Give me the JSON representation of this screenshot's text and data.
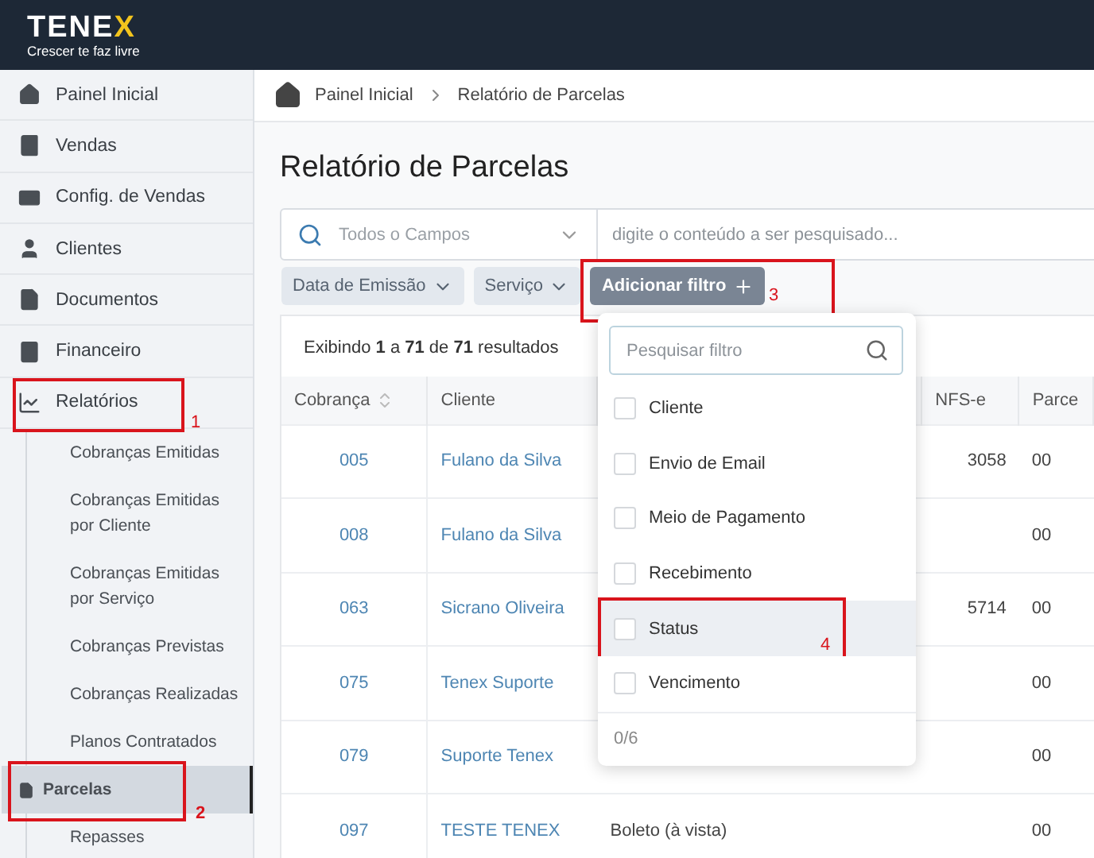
{
  "logo": {
    "name": "TENEX",
    "tagline": "Crescer te faz livre"
  },
  "sidebar": {
    "items": [
      {
        "label": "Painel Inicial",
        "selected": false
      },
      {
        "label": "Vendas",
        "selected": false
      },
      {
        "label": "Config. de Vendas",
        "selected": false
      },
      {
        "label": "Clientes",
        "selected": false
      },
      {
        "label": "Documentos",
        "selected": false
      },
      {
        "label": "Financeiro",
        "selected": false
      },
      {
        "label": "Relatórios",
        "selected": false,
        "annotation": "1",
        "children": [
          {
            "label": "Cobranças Emitidas",
            "selected": false
          },
          {
            "label": "Cobranças Emitidas por Cliente",
            "selected": false
          },
          {
            "label": "Cobranças Emitidas por Serviço",
            "selected": false
          },
          {
            "label": "Cobranças Previstas",
            "selected": false
          },
          {
            "label": "Cobranças Realizadas",
            "selected": false
          },
          {
            "label": "Planos Contratados",
            "selected": false
          },
          {
            "label": "Parcelas",
            "selected": true,
            "annotation": "2"
          },
          {
            "label": "Repasses",
            "selected": false
          }
        ]
      }
    ]
  },
  "breadcrumb": [
    "Painel Inicial",
    "Relatório de Parcelas"
  ],
  "title": "Relatório de Parcelas",
  "search": {
    "field": "Todos o Campos",
    "placeholder": "digite o conteúdo a ser pesquisado..."
  },
  "filters": [
    {
      "label": "Data de Emissão",
      "kind": "chip"
    },
    {
      "label": "Serviço",
      "kind": "chip"
    },
    {
      "label": "Adicionar filtro",
      "kind": "add",
      "annotation": "3"
    }
  ],
  "results": "Exibindo **1** a **71** de **71** resultados",
  "table": {
    "columns": [
      "Cobrança",
      "Cliente",
      "",
      "NFS-e",
      "Parce"
    ],
    "rows": [
      [
        "005",
        "Fulano da Silva",
        "",
        "3058",
        "00"
      ],
      [
        "008",
        "Fulano da Silva",
        "",
        "",
        "00"
      ],
      [
        "063",
        "Sicrano Oliveira",
        "",
        "5714",
        "00"
      ],
      [
        "075",
        "Tenex Suporte",
        "",
        "",
        "00"
      ],
      [
        "079",
        "Suporte Tenex",
        "",
        "",
        "00"
      ],
      [
        "097",
        "TESTE TENEX",
        "Boleto (à vista)",
        "",
        "00"
      ]
    ]
  },
  "filter_menu": {
    "placeholder": "Pesquisar filtro",
    "count": "0/6",
    "options": [
      {
        "label": "Cliente",
        "checked": false,
        "selected": false
      },
      {
        "label": "Envio de Email",
        "checked": false,
        "selected": false
      },
      {
        "label": "Meio de Pagamento",
        "checked": false,
        "selected": false
      },
      {
        "label": "Recebimento",
        "checked": false,
        "selected": false
      },
      {
        "label": "Status",
        "checked": false,
        "selected": true,
        "annotation": "4"
      },
      {
        "label": "Vencimento",
        "checked": false,
        "selected": false
      }
    ]
  }
}
